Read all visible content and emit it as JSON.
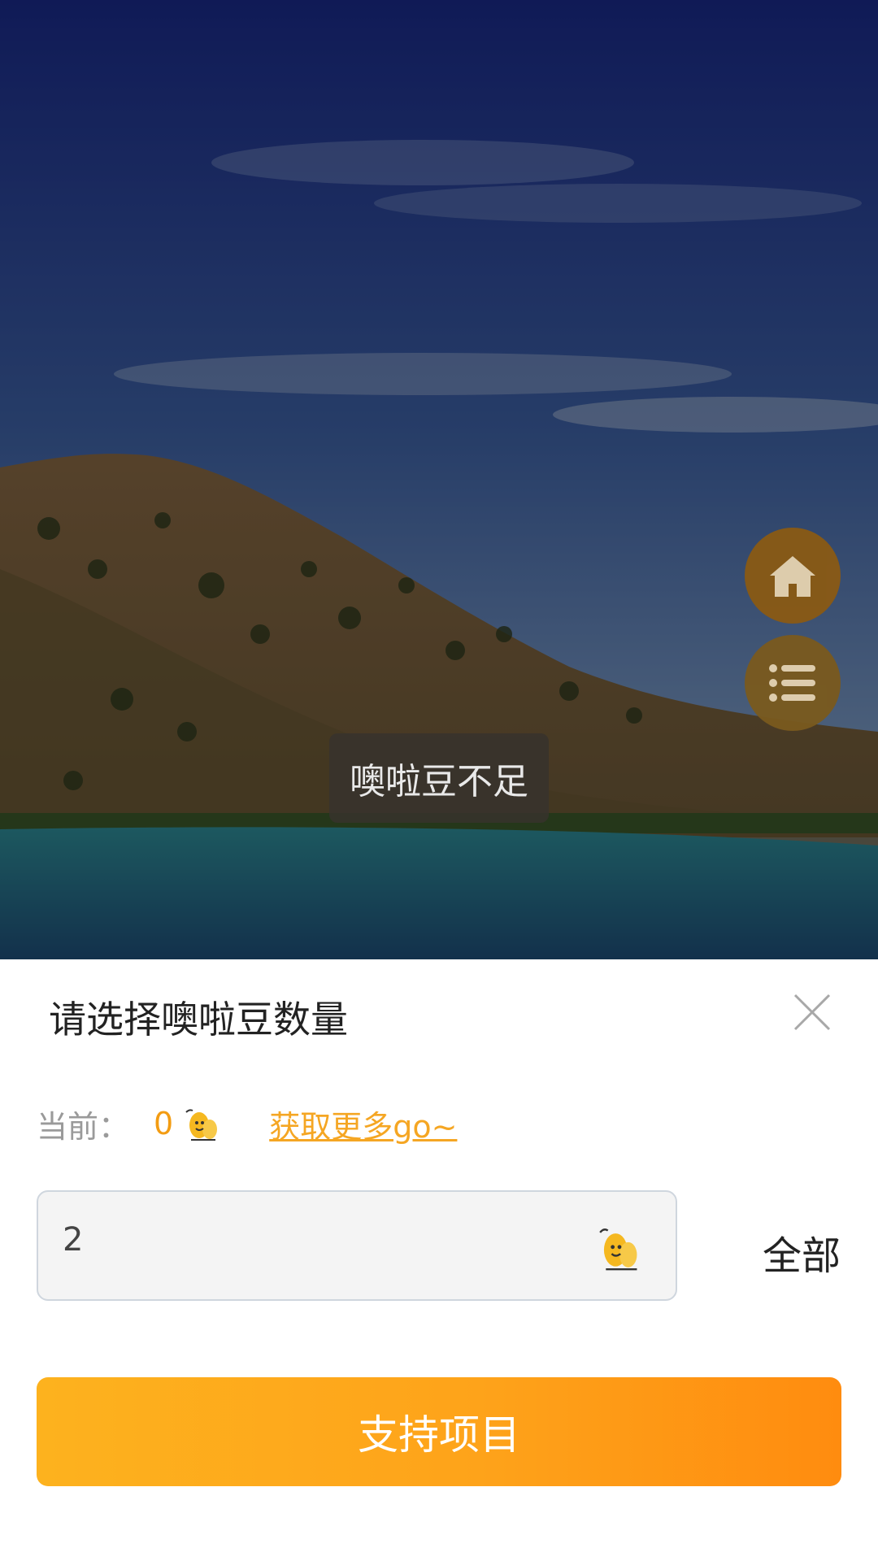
{
  "toast": {
    "text": "噢啦豆不足"
  },
  "floating": {
    "home_icon": "home-icon",
    "list_icon": "list-icon"
  },
  "sheet": {
    "title": "请选择噢啦豆数量",
    "current_label": "当前：",
    "current_value": "0",
    "more_link": "获取更多go~",
    "amount_value": "2",
    "all_label": "全部",
    "support_label": "支持项目"
  },
  "colors": {
    "accent": "#f5a623",
    "button_start": "#fdb21e",
    "button_end": "#ff8c0f",
    "fab": "#8a5a14"
  }
}
